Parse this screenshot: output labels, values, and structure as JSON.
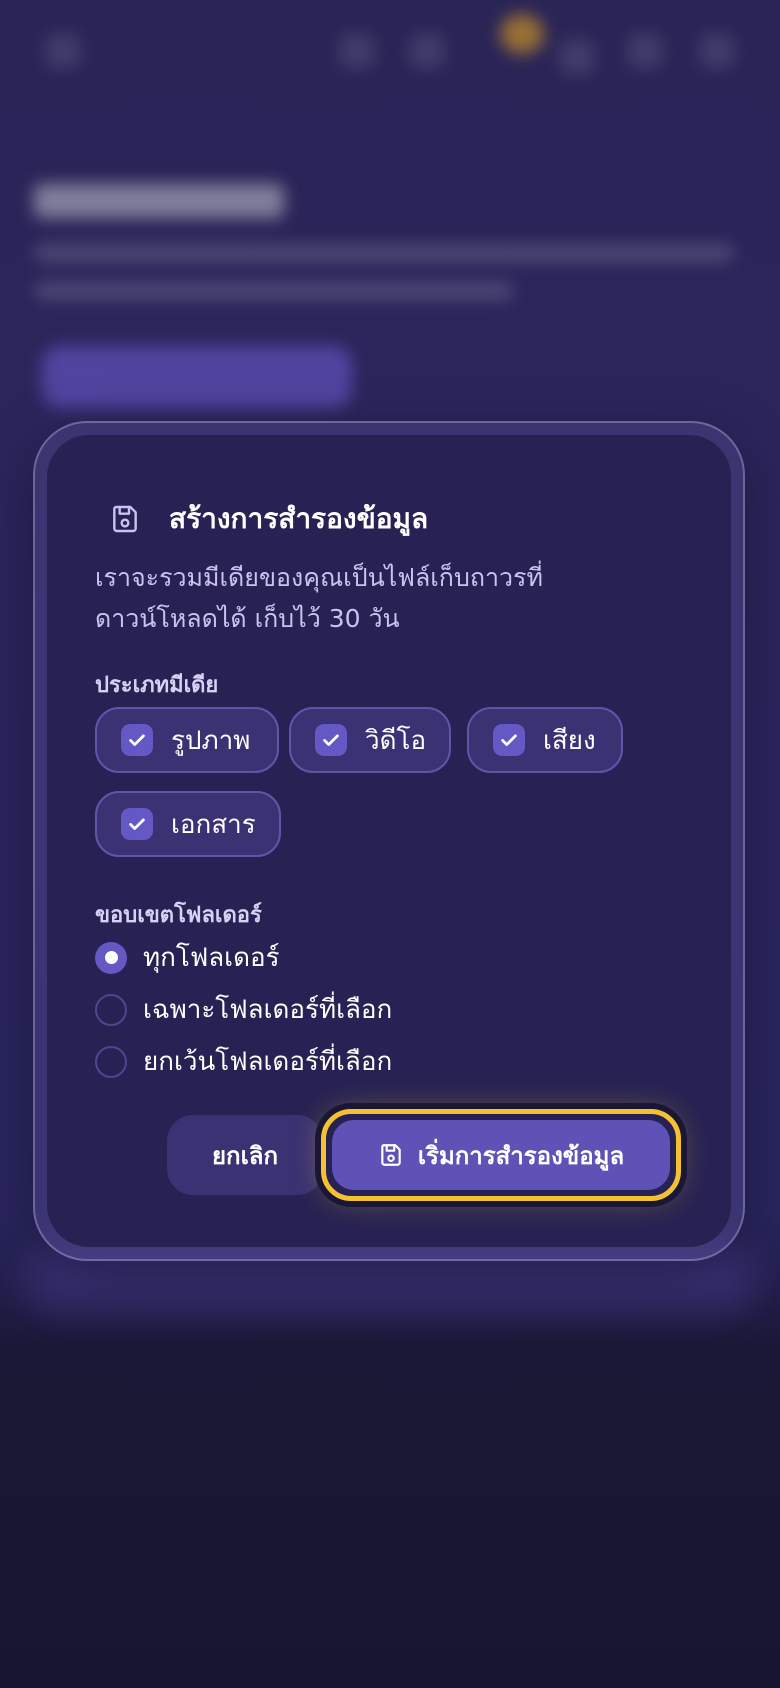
{
  "dialog": {
    "title": "สร้างการสำรองข้อมูล",
    "title_icon": "save-icon",
    "description": "เราจะรวมมีเดียของคุณเป็นไฟล์เก็บถาวรที่ดาวน์โหลดได้ เก็บไว้ 30 วัน"
  },
  "media_types": {
    "label": "ประเภทมีเดีย",
    "options": [
      {
        "label": "รูปภาพ",
        "checked": true
      },
      {
        "label": "วิดีโอ",
        "checked": true
      },
      {
        "label": "เสียง",
        "checked": true
      },
      {
        "label": "เอกสาร",
        "checked": true
      }
    ]
  },
  "folder_scope": {
    "label": "ขอบเขตโฟลเดอร์",
    "options": [
      {
        "label": "ทุกโฟลเดอร์",
        "selected": true
      },
      {
        "label": "เฉพาะโฟลเดอร์ที่เลือก",
        "selected": false
      },
      {
        "label": "ยกเว้นโฟลเดอร์ที่เลือก",
        "selected": false
      }
    ]
  },
  "actions": {
    "cancel_label": "ยกเลิก",
    "start_label": "เริ่มการสำรองข้อมูล",
    "start_icon": "save-icon"
  },
  "colors": {
    "accent": "#5e52b6",
    "checkbox": "#6459c4",
    "focus_ring": "#f4c230",
    "dialog_bg": "#272253",
    "chip_bg": "#3a3272"
  }
}
